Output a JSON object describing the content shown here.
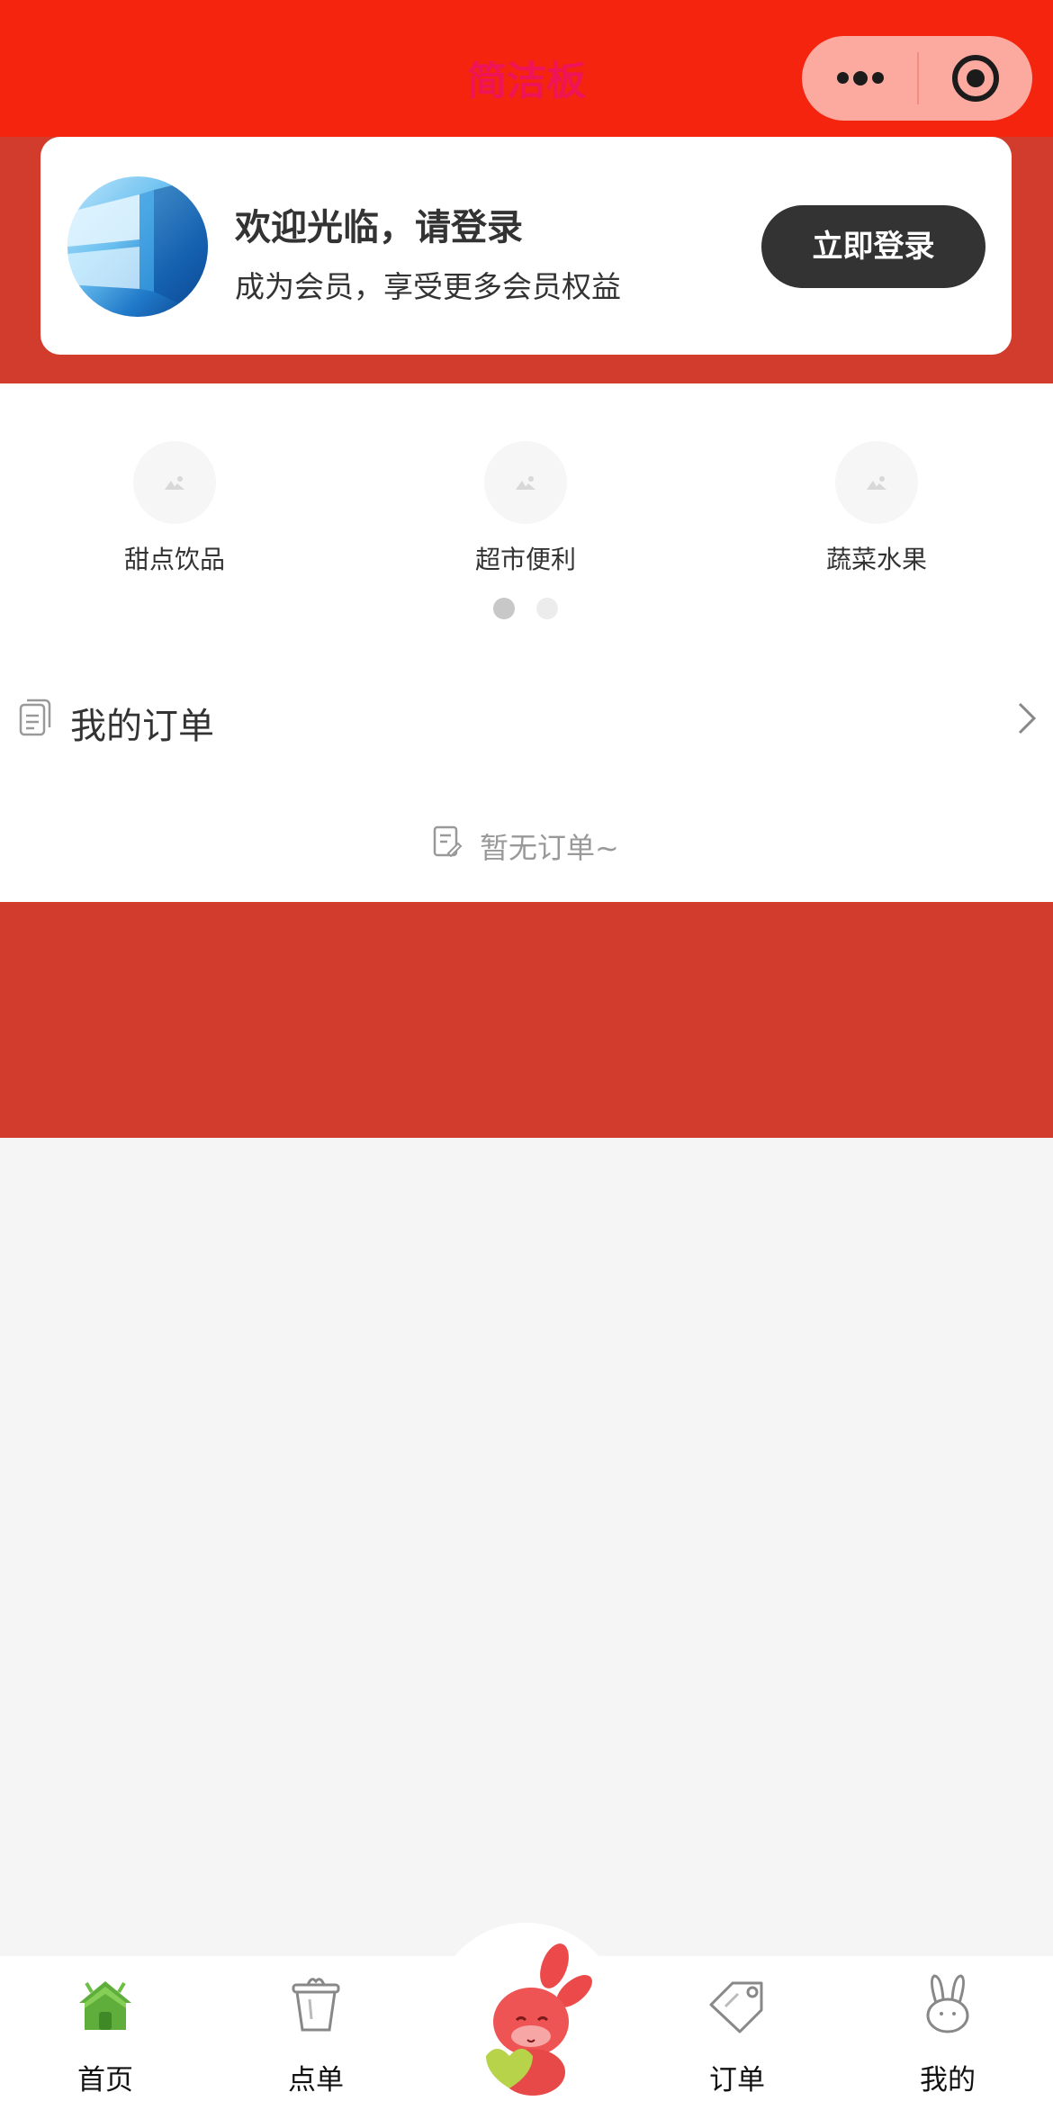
{
  "header": {
    "title": "简洁板",
    "bg_color": "#f4240e",
    "title_color": "#ee1457",
    "capsule": {
      "more_icon": "more-dots-icon",
      "close_icon": "target-circle-icon"
    }
  },
  "login_card": {
    "avatar_icon": "windows-wallpaper-avatar",
    "welcome": "欢迎光临，请登录",
    "subtitle": "成为会员，享受更多会员权益",
    "login_button": "立即登录"
  },
  "categories": {
    "items": [
      {
        "label": "甜点饮品",
        "icon": "image-placeholder-icon"
      },
      {
        "label": "超市便利",
        "icon": "image-placeholder-icon"
      },
      {
        "label": "蔬菜水果",
        "icon": "image-placeholder-icon"
      }
    ],
    "pager": {
      "pages": 2,
      "active_index": 0
    }
  },
  "orders": {
    "title": "我的订单",
    "title_icon": "document-icon",
    "arrow_icon": "chevron-right-icon",
    "empty_icon": "note-edit-icon",
    "empty_text": "暂无订单~"
  },
  "promo": {
    "bg_color": "#d13c2d"
  },
  "tabbar": {
    "items": [
      {
        "label": "首页",
        "icon": "home-icon"
      },
      {
        "label": "点单",
        "icon": "cup-icon"
      },
      {
        "label": "",
        "icon": "rabbit-mascot-icon"
      },
      {
        "label": "订单",
        "icon": "tag-icon"
      },
      {
        "label": "我的",
        "icon": "rabbit-head-icon"
      }
    ]
  }
}
